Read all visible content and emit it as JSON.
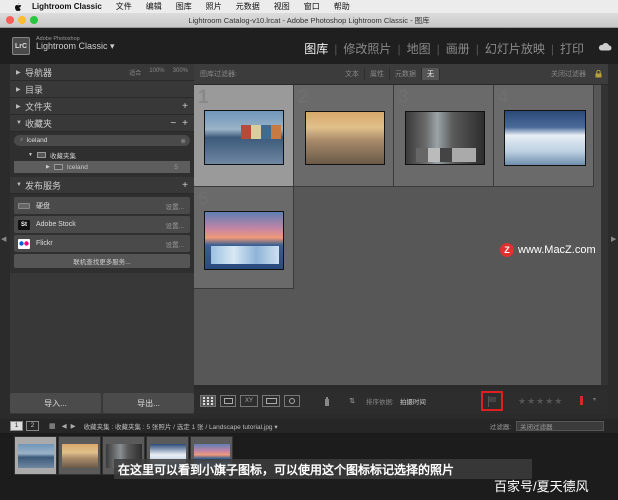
{
  "menubar": {
    "app_name": "Lightroom Classic",
    "items": [
      "文件",
      "编辑",
      "图库",
      "照片",
      "元数据",
      "视图",
      "窗口",
      "帮助"
    ]
  },
  "window": {
    "title": "Lightroom Catalog-v10.lrcat - Adobe Photoshop Lightroom Classic - 图库"
  },
  "identity": {
    "badge": "LrC",
    "brand_small": "Adobe Photoshop",
    "brand_big": "Lightroom Classic ▾"
  },
  "modules": [
    "图库",
    "修改照片",
    "地图",
    "画册",
    "幻灯片放映",
    "打印"
  ],
  "left_panel": {
    "navigator": {
      "title": "导航器",
      "extras": [
        "适合",
        "100%",
        "300%"
      ]
    },
    "catalog": {
      "title": "目录"
    },
    "folders": {
      "title": "文件夹"
    },
    "collections": {
      "title": "收藏夹",
      "filter_value": "Iceland",
      "set_label": "收藏夹集",
      "child_label": "Iceland",
      "child_count": "5"
    },
    "publish": {
      "title": "发布服务",
      "services": [
        {
          "name": "硬盘",
          "setup": "设置..."
        },
        {
          "name": "Adobe Stock",
          "setup": "设置..."
        },
        {
          "name": "Flickr",
          "setup": "设置..."
        }
      ],
      "find_more": "联机查找更多服务..."
    },
    "import_label": "导入...",
    "export_label": "导出..."
  },
  "filter_bar": {
    "title": "图库过滤器:",
    "tabs": [
      "文本",
      "属性",
      "元数据",
      "无"
    ],
    "active_tab": "无",
    "off_label": "关闭过滤器"
  },
  "grid": {
    "cells": [
      "1",
      "2",
      "3",
      "4",
      "5"
    ]
  },
  "toolbar": {
    "sort_label": "排序依据:",
    "sort_value": "拍摄时间",
    "stars": "★★★★★"
  },
  "filmstrip_bar": {
    "page1": "1",
    "page2": "2",
    "path": "收藏夹集 : 收藏夹集 : 5 张照片 / 选定 1 张 / Landscape tutorial.jpg ▾",
    "filter_label": "过滤器:",
    "filter_value": "关闭过滤器"
  },
  "annotations": {
    "caption": "在这里可以看到小旗子图标，可以使用这个图标标记选择的照片",
    "watermark_site": "www.MacZ.com",
    "watermark_author": "百家号/夏天德风"
  },
  "colors": {
    "flag_highlight": "#e02020",
    "grid_bg": "#575757",
    "selected_cell": "#9a9a9a"
  }
}
